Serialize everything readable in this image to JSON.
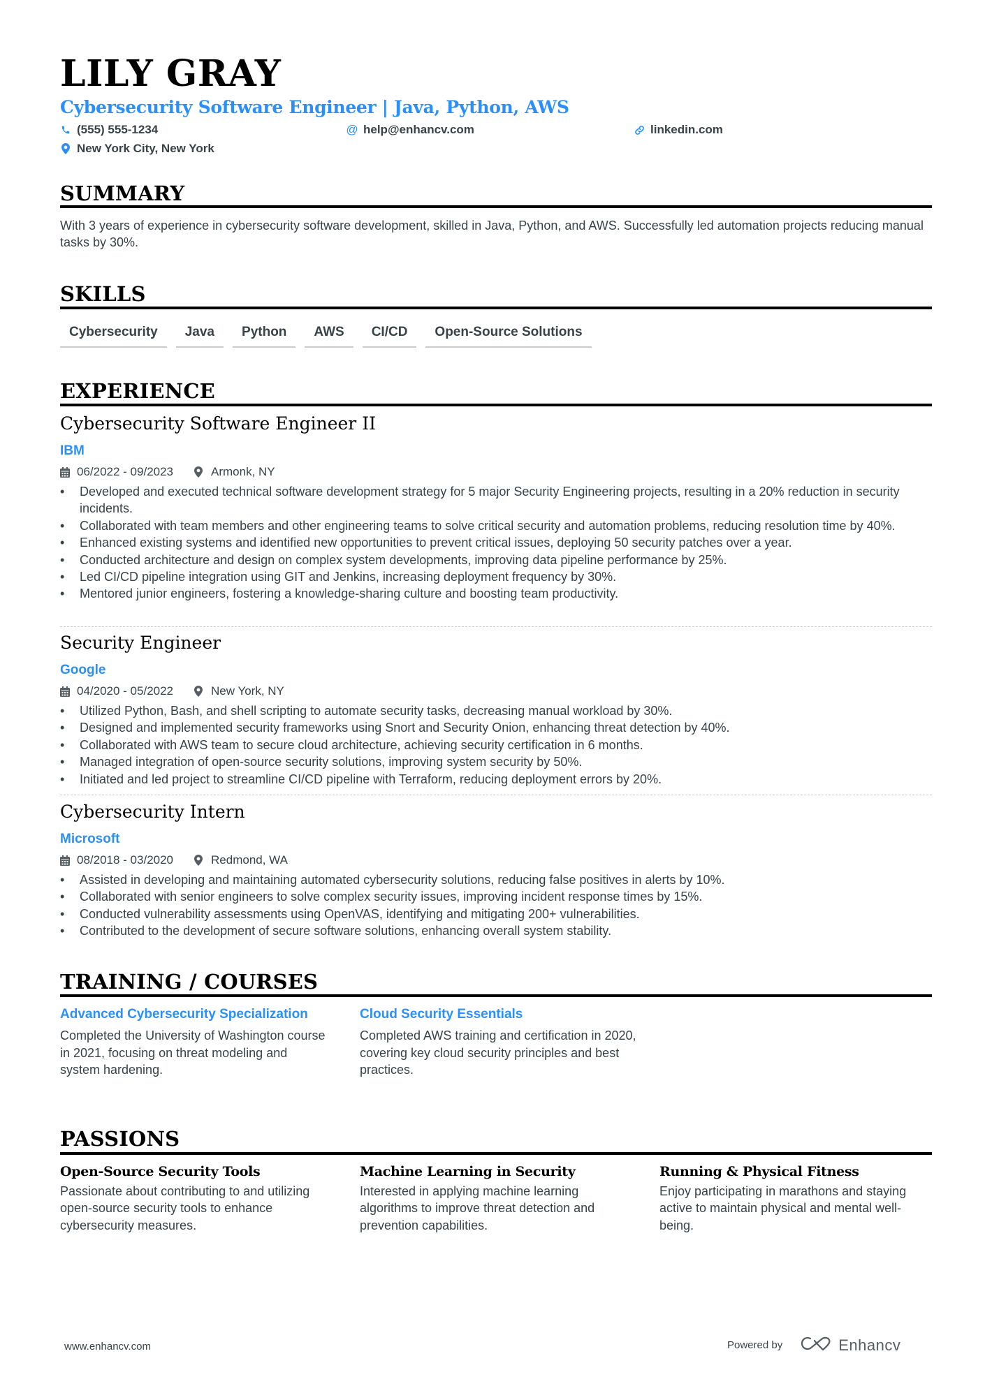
{
  "header": {
    "name": "LILY GRAY",
    "headline": "Cybersecurity Software Engineer | Java, Python, AWS",
    "contact": {
      "phone": "(555) 555-1234",
      "email": "help@enhancv.com",
      "link": "linkedin.com",
      "location": "New York City, New York"
    },
    "icons": {
      "phone": "phone-icon",
      "email": "at-icon",
      "link": "link-icon",
      "location": "map-pin-icon"
    }
  },
  "sections": {
    "summary": "SUMMARY",
    "skills": "SKILLS",
    "experience": "EXPERIENCE",
    "training": "TRAINING / COURSES",
    "passions": "PASSIONS"
  },
  "summary": {
    "text": "With 3 years of experience in cybersecurity software development, skilled in Java, Python, and AWS. Successfully led automation projects reducing manual tasks by 30%."
  },
  "skills": [
    "Cybersecurity",
    "Java",
    "Python",
    "AWS",
    "CI/CD",
    "Open-Source Solutions"
  ],
  "experience": [
    {
      "title": "Cybersecurity Software Engineer II",
      "company": "IBM",
      "dates": "06/2022 - 09/2023",
      "location": "Armonk, NY",
      "bullets": [
        "Developed and executed technical software development strategy for 5 major Security Engineering projects, resulting in a 20% reduction in security incidents.",
        "Collaborated with team members and other engineering teams to solve critical security and automation problems, reducing resolution time by 40%.",
        "Enhanced existing systems and identified new opportunities to prevent critical issues, deploying 50 security patches over a year.",
        "Conducted architecture and design on complex system developments, improving data pipeline performance by 25%.",
        "Led CI/CD pipeline integration using GIT and Jenkins, increasing deployment frequency by 30%.",
        "Mentored junior engineers, fostering a knowledge-sharing culture and boosting team productivity."
      ]
    },
    {
      "title": "Security Engineer",
      "company": "Google",
      "dates": "04/2020 - 05/2022",
      "location": "New York, NY",
      "bullets": [
        "Utilized Python, Bash, and shell scripting to automate security tasks, decreasing manual workload by 30%.",
        "Designed and implemented security frameworks using Snort and Security Onion, enhancing threat detection by 40%.",
        "Collaborated with AWS team to secure cloud architecture, achieving security certification in 6 months.",
        "Managed integration of open-source security solutions, improving system security by 50%.",
        "Initiated and led project to streamline CI/CD pipeline with Terraform, reducing deployment errors by 20%."
      ]
    },
    {
      "title": "Cybersecurity Intern",
      "company": "Microsoft",
      "dates": "08/2018 - 03/2020",
      "location": "Redmond, WA",
      "bullets": [
        "Assisted in developing and maintaining automated cybersecurity solutions, reducing false positives in alerts by 10%.",
        "Collaborated with senior engineers to solve complex security issues, improving incident response times by 15%.",
        "Conducted vulnerability assessments using OpenVAS, identifying and mitigating 200+ vulnerabilities.",
        "Contributed to the development of secure software solutions, enhancing overall system stability."
      ]
    }
  ],
  "training": [
    {
      "title": "Advanced Cybersecurity Specialization",
      "description": "Completed the University of Washington course in 2021, focusing on threat modeling and system hardening."
    },
    {
      "title": "Cloud Security Essentials",
      "description": "Completed AWS training and certification in 2020, covering key cloud security principles and best practices."
    }
  ],
  "passions": [
    {
      "title": "Open-Source Security Tools",
      "description": "Passionate about contributing to and utilizing open-source security tools to enhance cybersecurity measures."
    },
    {
      "title": "Machine Learning in Security",
      "description": "Interested in applying machine learning algorithms to improve threat detection and prevention capabilities."
    },
    {
      "title": "Running & Physical Fitness",
      "description": "Enjoy participating in marathons and staying active to maintain physical and mental well-being."
    }
  ],
  "footer": {
    "website": "www.enhancv.com",
    "powered_by": "Powered by",
    "brand": "Enhancv"
  },
  "colors": {
    "accent": "#2b8ffa",
    "text": "#384347",
    "heading": "#000000",
    "skill_underline": "#c9cdd0"
  }
}
